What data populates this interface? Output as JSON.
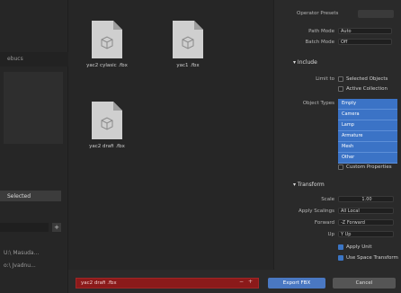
{
  "files": [
    {
      "name": "yac2 cylasic .fbx"
    },
    {
      "name": "yac1 .fbx"
    },
    {
      "name": "yac2 drafi .fbx"
    }
  ],
  "sidebar": {
    "label_1": "ebucs",
    "row_label": "Selected",
    "items": [
      "U:\\ Masuda...",
      "o:\\ Jvadnu..."
    ]
  },
  "settings": {
    "operator_presets_label": "Operator Presets",
    "path_mode_label": "Path Mode",
    "path_mode_value": "Auto",
    "batch_mode_label": "Batch Mode",
    "batch_mode_value": "Off",
    "include_section": "Include",
    "limit_to_label": "Limit to",
    "selected_objects_label": "Selected Objects",
    "active_collection_label": "Active Collection",
    "object_types_label": "Object Types",
    "object_types": [
      "Empty",
      "Camera",
      "Lamp",
      "Armature",
      "Mesh",
      "Other"
    ],
    "custom_properties_label": "Custom Properties",
    "transform_section": "Transform",
    "scale_label": "Scale",
    "scale_value": "1.00",
    "apply_scalings_label": "Apply Scalings",
    "apply_scalings_value": "All Local",
    "forward_label": "Forward",
    "forward_value": "-Z Forward",
    "up_label": "Up",
    "up_value": "Y Up",
    "apply_unit_label": "Apply Unit",
    "use_space_transform_label": "Use Space Transform"
  },
  "footer": {
    "filename": "yac2 drafi .fbx",
    "export_label": "Export FBX",
    "cancel_label": "Cancel"
  },
  "colors": {
    "accent": "#3b73c6",
    "filename_bg": "#8b1a1a",
    "background": "#2b2b2b"
  }
}
